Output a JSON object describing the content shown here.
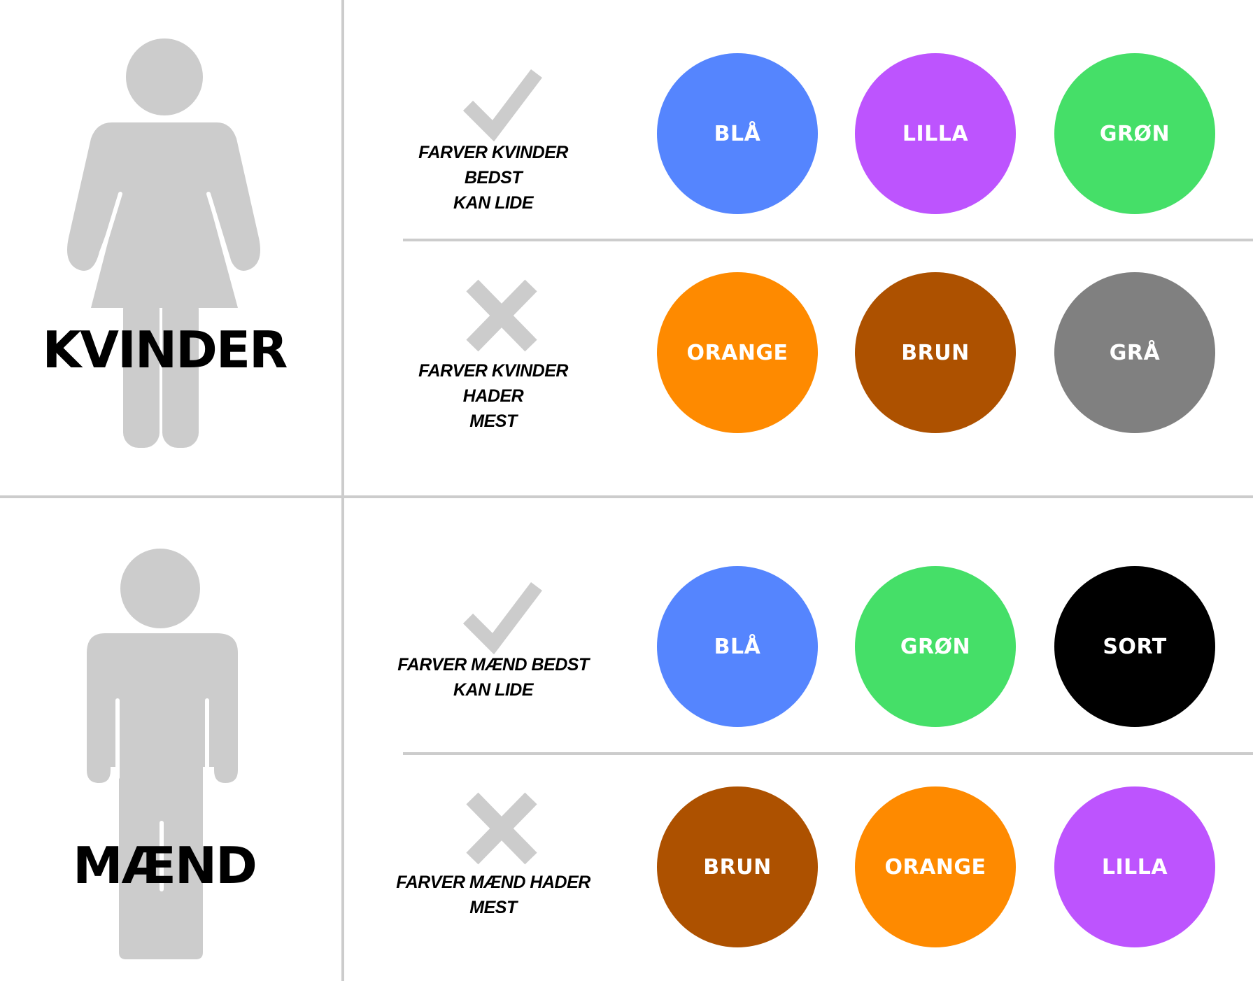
{
  "groups": [
    {
      "title": "KVINDER",
      "figure_icon": "woman-figure-icon",
      "rows": [
        {
          "verdict_icon": "checkmark-icon",
          "caption_line1": "FARVER KVINDER BEDST",
          "caption_line2": "KAN LIDE",
          "colors": [
            {
              "label": "BLÅ",
              "hex": "#5585fe"
            },
            {
              "label": "LILLA",
              "hex": "#bd54fe"
            },
            {
              "label": "GRØN",
              "hex": "#45df68"
            }
          ]
        },
        {
          "verdict_icon": "cross-icon",
          "caption_line1": "FARVER KVINDER HADER",
          "caption_line2": "MEST",
          "colors": [
            {
              "label": "ORANGE",
              "hex": "#fe8a00"
            },
            {
              "label": "BRUN",
              "hex": "#ad5100"
            },
            {
              "label": "GRÅ",
              "hex": "#808080"
            }
          ]
        }
      ]
    },
    {
      "title": "MÆND",
      "figure_icon": "man-figure-icon",
      "rows": [
        {
          "verdict_icon": "checkmark-icon",
          "caption_line1": "FARVER MÆND BEDST",
          "caption_line2": "KAN LIDE",
          "colors": [
            {
              "label": "BLÅ",
              "hex": "#5585fe"
            },
            {
              "label": "GRØN",
              "hex": "#45df68"
            },
            {
              "label": "SORT",
              "hex": "#000000"
            }
          ]
        },
        {
          "verdict_icon": "cross-icon",
          "caption_line1": "FARVER MÆND HADER",
          "caption_line2": "MEST",
          "colors": [
            {
              "label": "BRUN",
              "hex": "#ad5100"
            },
            {
              "label": "ORANGE",
              "hex": "#fe8a00"
            },
            {
              "label": "LILLA",
              "hex": "#bd54fe"
            }
          ]
        }
      ]
    }
  ],
  "palette": {
    "figure": "#cccccc",
    "divider": "#cccccc",
    "mark": "#cccccc",
    "swatch_text": "#ffffff"
  }
}
